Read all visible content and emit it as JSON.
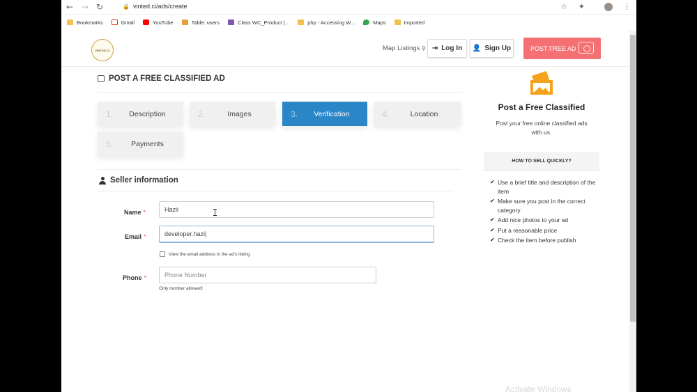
{
  "browser": {
    "url": "vinted.ci/ads/create",
    "bookmarks": [
      "Bookmarks",
      "Gmail",
      "YouTube",
      "Table: users",
      "Class WC_Product (...",
      "php - Accessing W...",
      "Maps",
      "Imported"
    ]
  },
  "header": {
    "logo_text": "VINTED.CI",
    "map_listings": "Map Listings",
    "login_label": "Log In",
    "signup_label": "Sign Up",
    "post_ad_label": "POST FREE AD"
  },
  "form": {
    "title": "POST A FREE CLASSIFIED AD",
    "steps": [
      {
        "num": "1.",
        "label": "Description"
      },
      {
        "num": "2.",
        "label": "Images"
      },
      {
        "num": "3.",
        "label": "Verification"
      },
      {
        "num": "4.",
        "label": "Location"
      },
      {
        "num": "5.",
        "label": "Payments"
      }
    ],
    "active_step": 3,
    "section_title": "Seller information",
    "name_label": "Name",
    "name_value": "Hazii",
    "email_label": "Email",
    "email_value": "developer.hazi|",
    "checkbox_label": "View the email address in the ad's listing",
    "phone_label": "Phone",
    "phone_placeholder": "Phone Number",
    "phone_helper": "Only number allowed!",
    "required_mark": "*"
  },
  "sidebar": {
    "title": "Post a Free Classified",
    "description": "Post your free online classified ads with us.",
    "how_to_title": "HOW TO SELL QUICKLY?",
    "tips": [
      "Use a brief title and description of the item",
      "Make sure you post in the correct category",
      "Add nice photos to your ad",
      "Put a reasonable price",
      "Check the item before publish"
    ]
  },
  "watermark": "Activate Windows",
  "colors": {
    "accent_blue": "#2a86c7",
    "post_button": "#f47072",
    "icon_orange": "#f7a21b"
  }
}
